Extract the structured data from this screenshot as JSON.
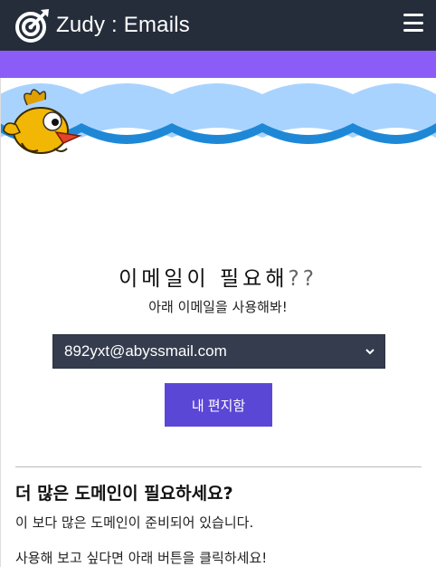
{
  "app": {
    "title": "Zudy : Emails"
  },
  "icons": {
    "brand": "target-logo-icon",
    "menu": "hamburger-menu-icon",
    "select_arrow": "chevron-down-icon",
    "mascot": "bird-mascot-icon"
  },
  "colors": {
    "navbar": "#252d3b",
    "accent_bar": "#8b5cf6",
    "cloud_light": "#a9d3ff",
    "cloud_dark": "#1e88d6",
    "select_bg": "#343c4e",
    "button_bg": "#5b47d6"
  },
  "main": {
    "heading": "이메일이 필요해",
    "heading_suffix": "??",
    "subheading": "아래 이메일을 사용해봐!",
    "email_select": {
      "value": "892yxt@abyssmail.com"
    },
    "inbox_button": "내 편지함"
  },
  "more_domains": {
    "title": "더 많은 도메인이 필요하세요?",
    "text1": "이 보다 많은 도메인이 준비되어 있습니다.",
    "text2": "사용해 보고 싶다면 아래 버튼을 클릭하세요!"
  }
}
